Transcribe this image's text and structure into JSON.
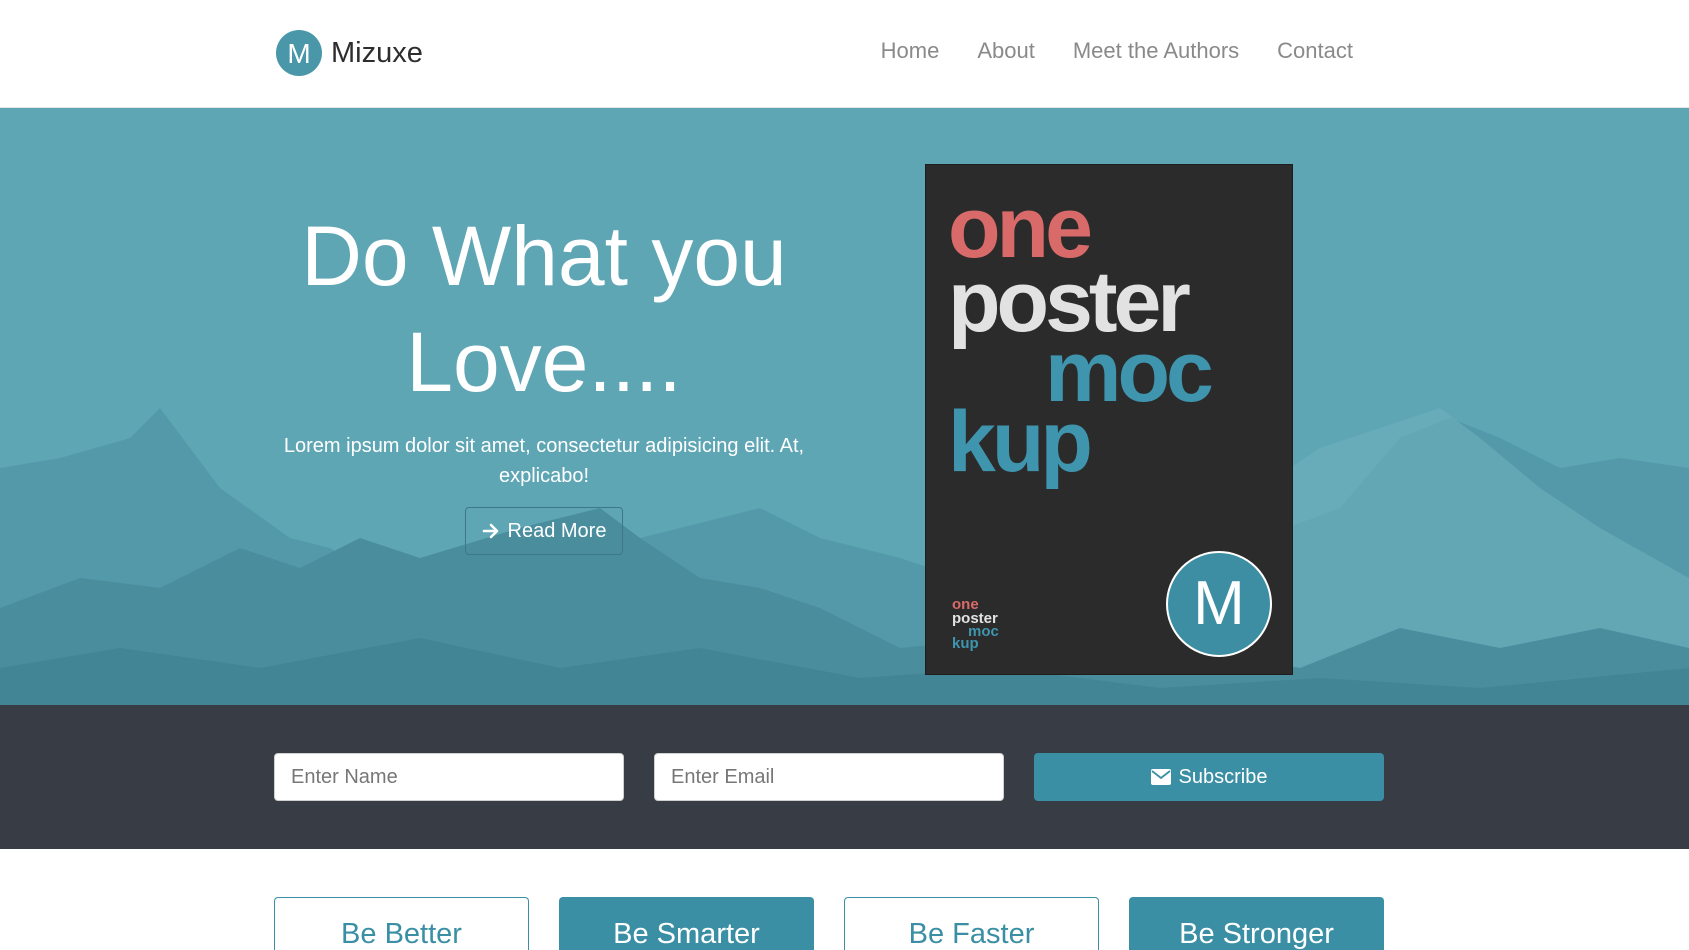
{
  "brand": {
    "name": "Mizuxe",
    "logo_letter": "M",
    "logo_color": "#4a97aa"
  },
  "nav": {
    "items": [
      "Home",
      "About",
      "Meet the Authors",
      "Contact"
    ]
  },
  "hero": {
    "title": "Do What you Love....",
    "subtitle": "Lorem ipsum dolor sit amet, consectetur adipisicing elit. At, explicabo!",
    "button_label": "Read More",
    "button_icon": "arrow-right-icon",
    "background_color": "#5fa6b5"
  },
  "poster": {
    "lines": [
      "one",
      "poster",
      "moc",
      "kup"
    ],
    "badge_letter": "M",
    "colors": {
      "one": "#d86a6a",
      "poster": "#e2e2e2",
      "mockup": "#3e95ad",
      "background": "#2b2b2b"
    }
  },
  "subscribe": {
    "name_placeholder": "Enter Name",
    "email_placeholder": "Enter Email",
    "button_label": "Subscribe",
    "button_icon": "envelope-icon",
    "band_color": "#373c45",
    "accent": "#3b8fa4"
  },
  "features": [
    {
      "label": "Be Better",
      "filled": false
    },
    {
      "label": "Be Smarter",
      "filled": true
    },
    {
      "label": "Be Faster",
      "filled": false
    },
    {
      "label": "Be Stronger",
      "filled": true
    }
  ]
}
